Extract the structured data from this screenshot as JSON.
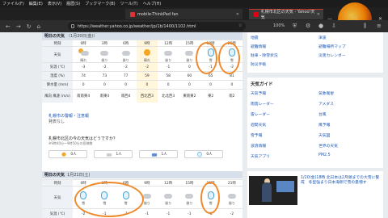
{
  "browser": {
    "menu": [
      "ファイル(F)",
      "編集(E)",
      "表示(V)",
      "履歴(S)",
      "ブックマーク(B)",
      "ツール(T)",
      "ヘルプ(H)"
    ],
    "tabs": [
      {
        "title": "mobile-ThinkPad fan"
      },
      {
        "title": "札幌市北区の天気 - Yahoo!天気"
      }
    ],
    "url": "https://weather.yahoo.co.jp/weather/jp/1b/1400/1102.html",
    "zoom": "100%",
    "window_buttons": [
      "—",
      "▢",
      "✕"
    ]
  },
  "today": {
    "header": "明日の天気",
    "date_note": "（1月20日(金)）",
    "labels": {
      "time": "時刻",
      "weather": "天気",
      "temp": "気温 (℃)",
      "humidity": "湿度 (%)",
      "precip": "降水量 (mm)",
      "wind": "風向 風速 (m/s)"
    },
    "columns": [
      {
        "time": "0時",
        "weather": "晴れ",
        "icon": "sun-cloud",
        "temp": "-3",
        "humidity": "74",
        "precip": "0",
        "wdir": "南南東",
        "wspd": "4"
      },
      {
        "time": "3時",
        "weather": "曇り",
        "icon": "cloud",
        "temp": "-2",
        "humidity": "73",
        "precip": "0",
        "wdir": "南東",
        "wspd": "4"
      },
      {
        "time": "6時",
        "weather": "曇り",
        "icon": "cloud",
        "temp": "-2",
        "humidity": "77",
        "precip": "0",
        "wdir": "南西",
        "wspd": "4"
      },
      {
        "time": "9時",
        "weather": "晴れ",
        "icon": "sun",
        "temp": "-2",
        "humidity": "59",
        "precip": "0",
        "wdir": "西北西",
        "wspd": "3"
      },
      {
        "time": "12時",
        "weather": "曇り",
        "icon": "cloud",
        "temp": "-1",
        "humidity": "58",
        "precip": "0",
        "wdir": "北北西",
        "wspd": "3"
      },
      {
        "time": "15時",
        "weather": "曇り",
        "icon": "cloud",
        "temp": "0",
        "humidity": "60",
        "precip": "0",
        "wdir": "東南東",
        "wspd": "2"
      },
      {
        "time": "18時",
        "weather": "雪",
        "icon": "snow",
        "temp": "-1",
        "humidity": "65",
        "precip": "0",
        "wdir": "東",
        "wspd": "2"
      },
      {
        "time": "21時",
        "weather": "雪",
        "icon": "snow",
        "temp": "-2",
        "humidity": "81",
        "precip": "0",
        "wdir": "南",
        "wspd": "2"
      }
    ]
  },
  "warning_link": "札幌市の警報・注意報",
  "warning_sub": "発表なし",
  "poll": {
    "question": "札幌市北区の今の天気はどうですか？",
    "note": "※9時40分〜9時50分の投稿数",
    "options": [
      {
        "icon": "sun",
        "count": "0人"
      },
      {
        "icon": "cloud",
        "count": "1人"
      },
      {
        "icon": "rain",
        "count": "1人"
      },
      {
        "icon": "snow",
        "count": "0人"
      }
    ]
  },
  "tomorrow": {
    "header": "明日の天気",
    "date_note": "1月21日(土)",
    "columns": [
      {
        "time": "0時",
        "weather": "雪",
        "icon": "snow",
        "temp": "-2"
      },
      {
        "time": "3時",
        "weather": "雪",
        "icon": "snow",
        "temp": "-1"
      },
      {
        "time": "6時",
        "weather": "雪",
        "icon": "snow",
        "temp": "-1"
      },
      {
        "time": "9時",
        "weather": "曇り",
        "icon": "cloud",
        "temp": "-1"
      },
      {
        "time": "12時",
        "weather": "曇り",
        "icon": "cloud",
        "temp": "-1"
      },
      {
        "time": "15時",
        "weather": "曇り",
        "icon": "cloud",
        "temp": "-1"
      },
      {
        "time": "18時",
        "weather": "雪",
        "icon": "snow",
        "temp": "-2"
      },
      {
        "time": "21時",
        "weather": "曇り",
        "icon": "cloud",
        "temp": "-2"
      }
    ]
  },
  "sidebar": {
    "top_links": [
      [
        "地震",
        "津波"
      ],
      [
        "避難情報",
        "避難場所マップ"
      ],
      [
        "駐車・除雪状況",
        "災害カレンダー"
      ],
      [
        "防災手帳",
        ""
      ]
    ],
    "guide_title": "天気ガイド",
    "guide_links": [
      [
        "天気予報",
        "気象衛星"
      ],
      [
        "雨雲レーダー",
        "アメダス"
      ],
      [
        "雷レーダー",
        "台風"
      ],
      [
        "週間天気",
        "風予報"
      ],
      [
        "雪予報",
        "天気図"
      ],
      [
        "波浪情報",
        "世界の天気"
      ],
      [
        "天気アプリ",
        "PM2.5"
      ]
    ],
    "video_caption": "1/20(金)18時 北日本は2月頭までの大雪に警戒　冬型強まり日本海側で雪の量増す"
  }
}
